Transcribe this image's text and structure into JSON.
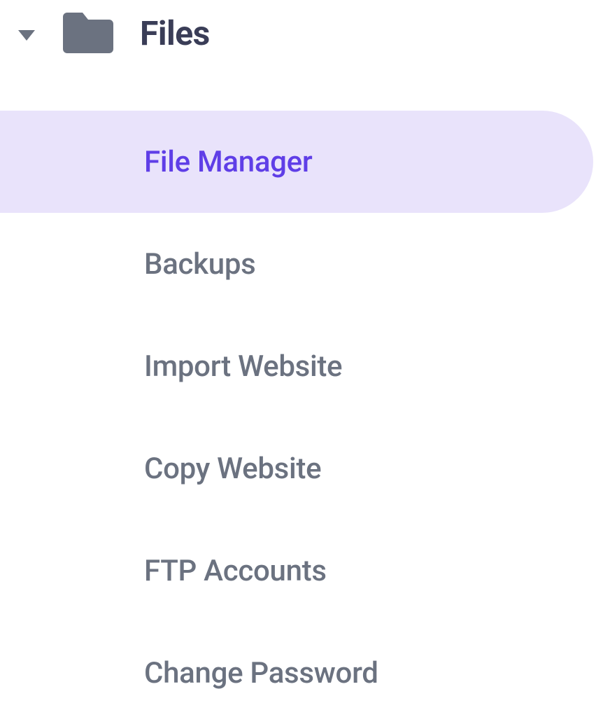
{
  "sidebar": {
    "section_title": "Files",
    "items": [
      {
        "label": "File Manager",
        "active": true
      },
      {
        "label": "Backups",
        "active": false
      },
      {
        "label": "Import Website",
        "active": false
      },
      {
        "label": "Copy Website",
        "active": false
      },
      {
        "label": "FTP Accounts",
        "active": false
      },
      {
        "label": "Change Password",
        "active": false
      }
    ]
  }
}
